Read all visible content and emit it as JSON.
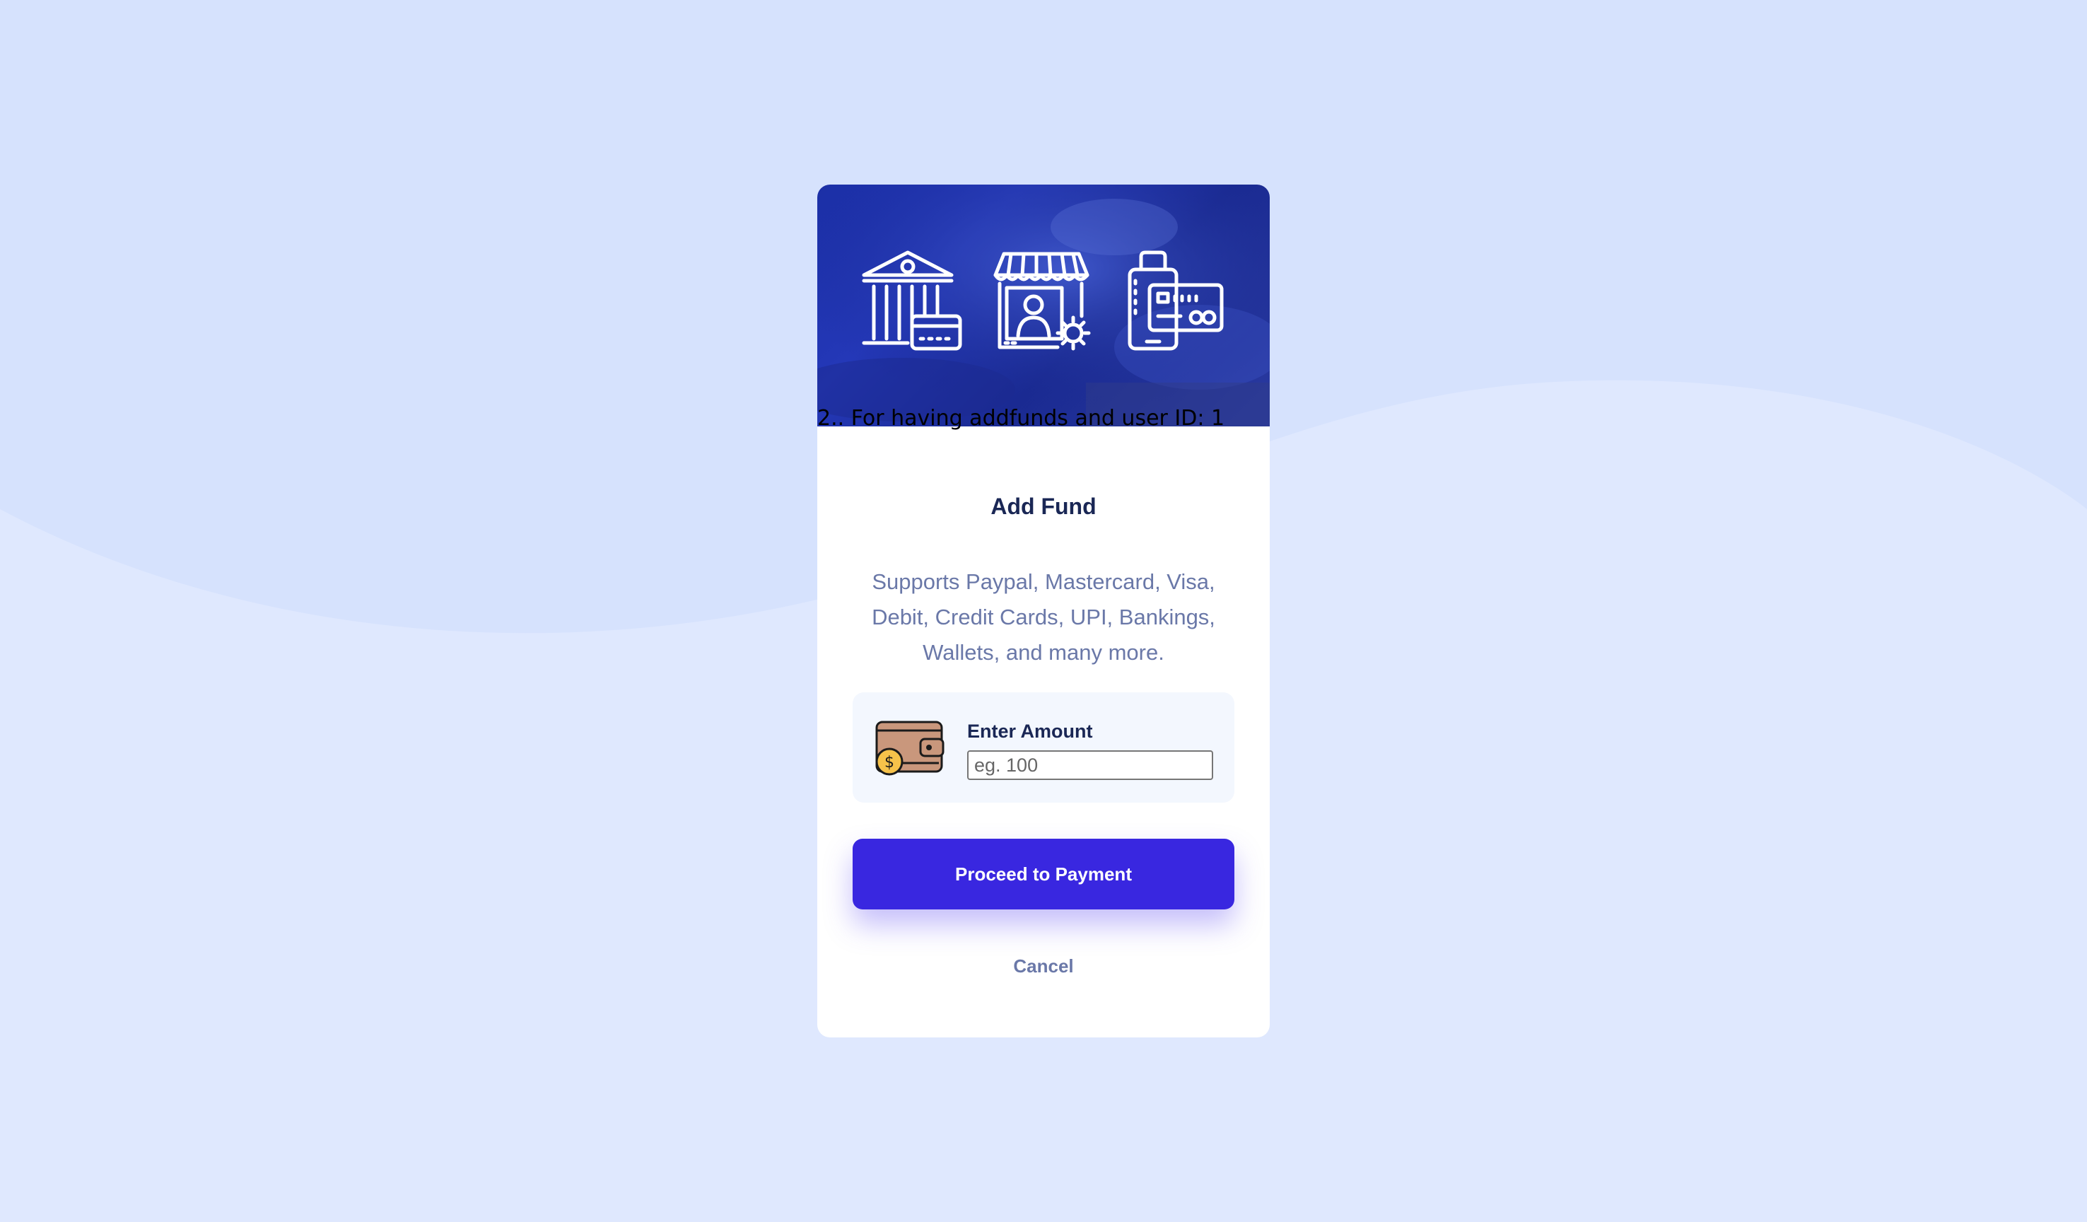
{
  "colors": {
    "background": "#d6e2fd",
    "card": "#ffffff",
    "banner": "#1b2fa6",
    "primary_button": "#3927e0",
    "title_text": "#1a2755",
    "muted_text": "#6a78a8",
    "amount_box": "#f3f7fe"
  },
  "banner": {
    "icons": [
      "bank-card-icon",
      "store-user-gear-icon",
      "mobile-card-payment-icon"
    ],
    "caption": "2.. For having addfunds and user ID: 1"
  },
  "modal": {
    "title": "Add Fund",
    "description": "Supports Paypal, Mastercard, Visa, Debit, Credit Cards, UPI, Bankings, Wallets, and many more."
  },
  "amount": {
    "label": "Enter Amount",
    "placeholder": "eg. 100",
    "value": "",
    "icon": "wallet-coin-icon"
  },
  "actions": {
    "proceed_label": "Proceed to Payment",
    "cancel_label": "Cancel"
  }
}
